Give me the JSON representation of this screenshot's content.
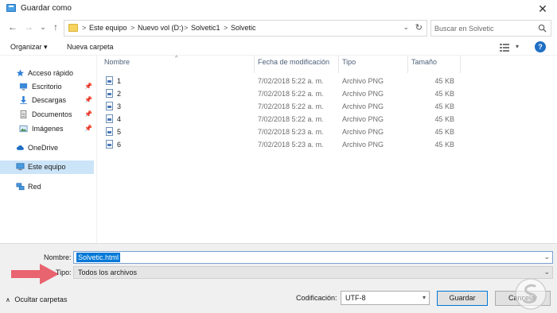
{
  "window": {
    "title": "Guardar como",
    "close_glyph": "✕"
  },
  "nav": {
    "back_glyph": "←",
    "forward_glyph": "→",
    "recent_glyph": "⌄",
    "up_glyph": "↑",
    "breadcrumb": [
      "Este equipo",
      "Nuevo vol (D:)",
      "Solvetic1",
      "Solvetic"
    ],
    "separator": ">",
    "search_placeholder": "Buscar en Solvetic"
  },
  "toolbar": {
    "organize_label": "Organizar ▾",
    "new_folder_label": "Nueva carpeta"
  },
  "sidebar": {
    "quick_access": "Acceso rápido",
    "pinned": [
      "Escritorio",
      "Descargas",
      "Documentos",
      "Imágenes"
    ],
    "onedrive": "OneDrive",
    "this_pc": "Este equipo",
    "network": "Red"
  },
  "columns": {
    "name": "Nombre",
    "date": "Fecha de modificación",
    "type": "Tipo",
    "size": "Tamaño"
  },
  "files": [
    {
      "name": "1",
      "date": "7/02/2018 5:22 a. m.",
      "type": "Archivo PNG",
      "size": "45 KB"
    },
    {
      "name": "2",
      "date": "7/02/2018 5:22 a. m.",
      "type": "Archivo PNG",
      "size": "45 KB"
    },
    {
      "name": "3",
      "date": "7/02/2018 5:22 a. m.",
      "type": "Archivo PNG",
      "size": "45 KB"
    },
    {
      "name": "4",
      "date": "7/02/2018 5:22 a. m.",
      "type": "Archivo PNG",
      "size": "45 KB"
    },
    {
      "name": "5",
      "date": "7/02/2018 5:23 a. m.",
      "type": "Archivo PNG",
      "size": "45 KB"
    },
    {
      "name": "6",
      "date": "7/02/2018 5:23 a. m.",
      "type": "Archivo PNG",
      "size": "45 KB"
    }
  ],
  "form": {
    "name_label": "Nombre:",
    "name_value": "Solvetic.html",
    "type_label": "Tipo:",
    "type_value": "Todos los archivos",
    "hide_folders": "Ocultar carpetas",
    "encoding_label": "Codificación:",
    "encoding_value": "UTF-8",
    "save_label": "Guardar",
    "cancel_label": "Cancelar"
  },
  "colors": {
    "accent": "#0078d7",
    "arrow": "#e8646f",
    "selected_bg": "#cce4f7"
  }
}
